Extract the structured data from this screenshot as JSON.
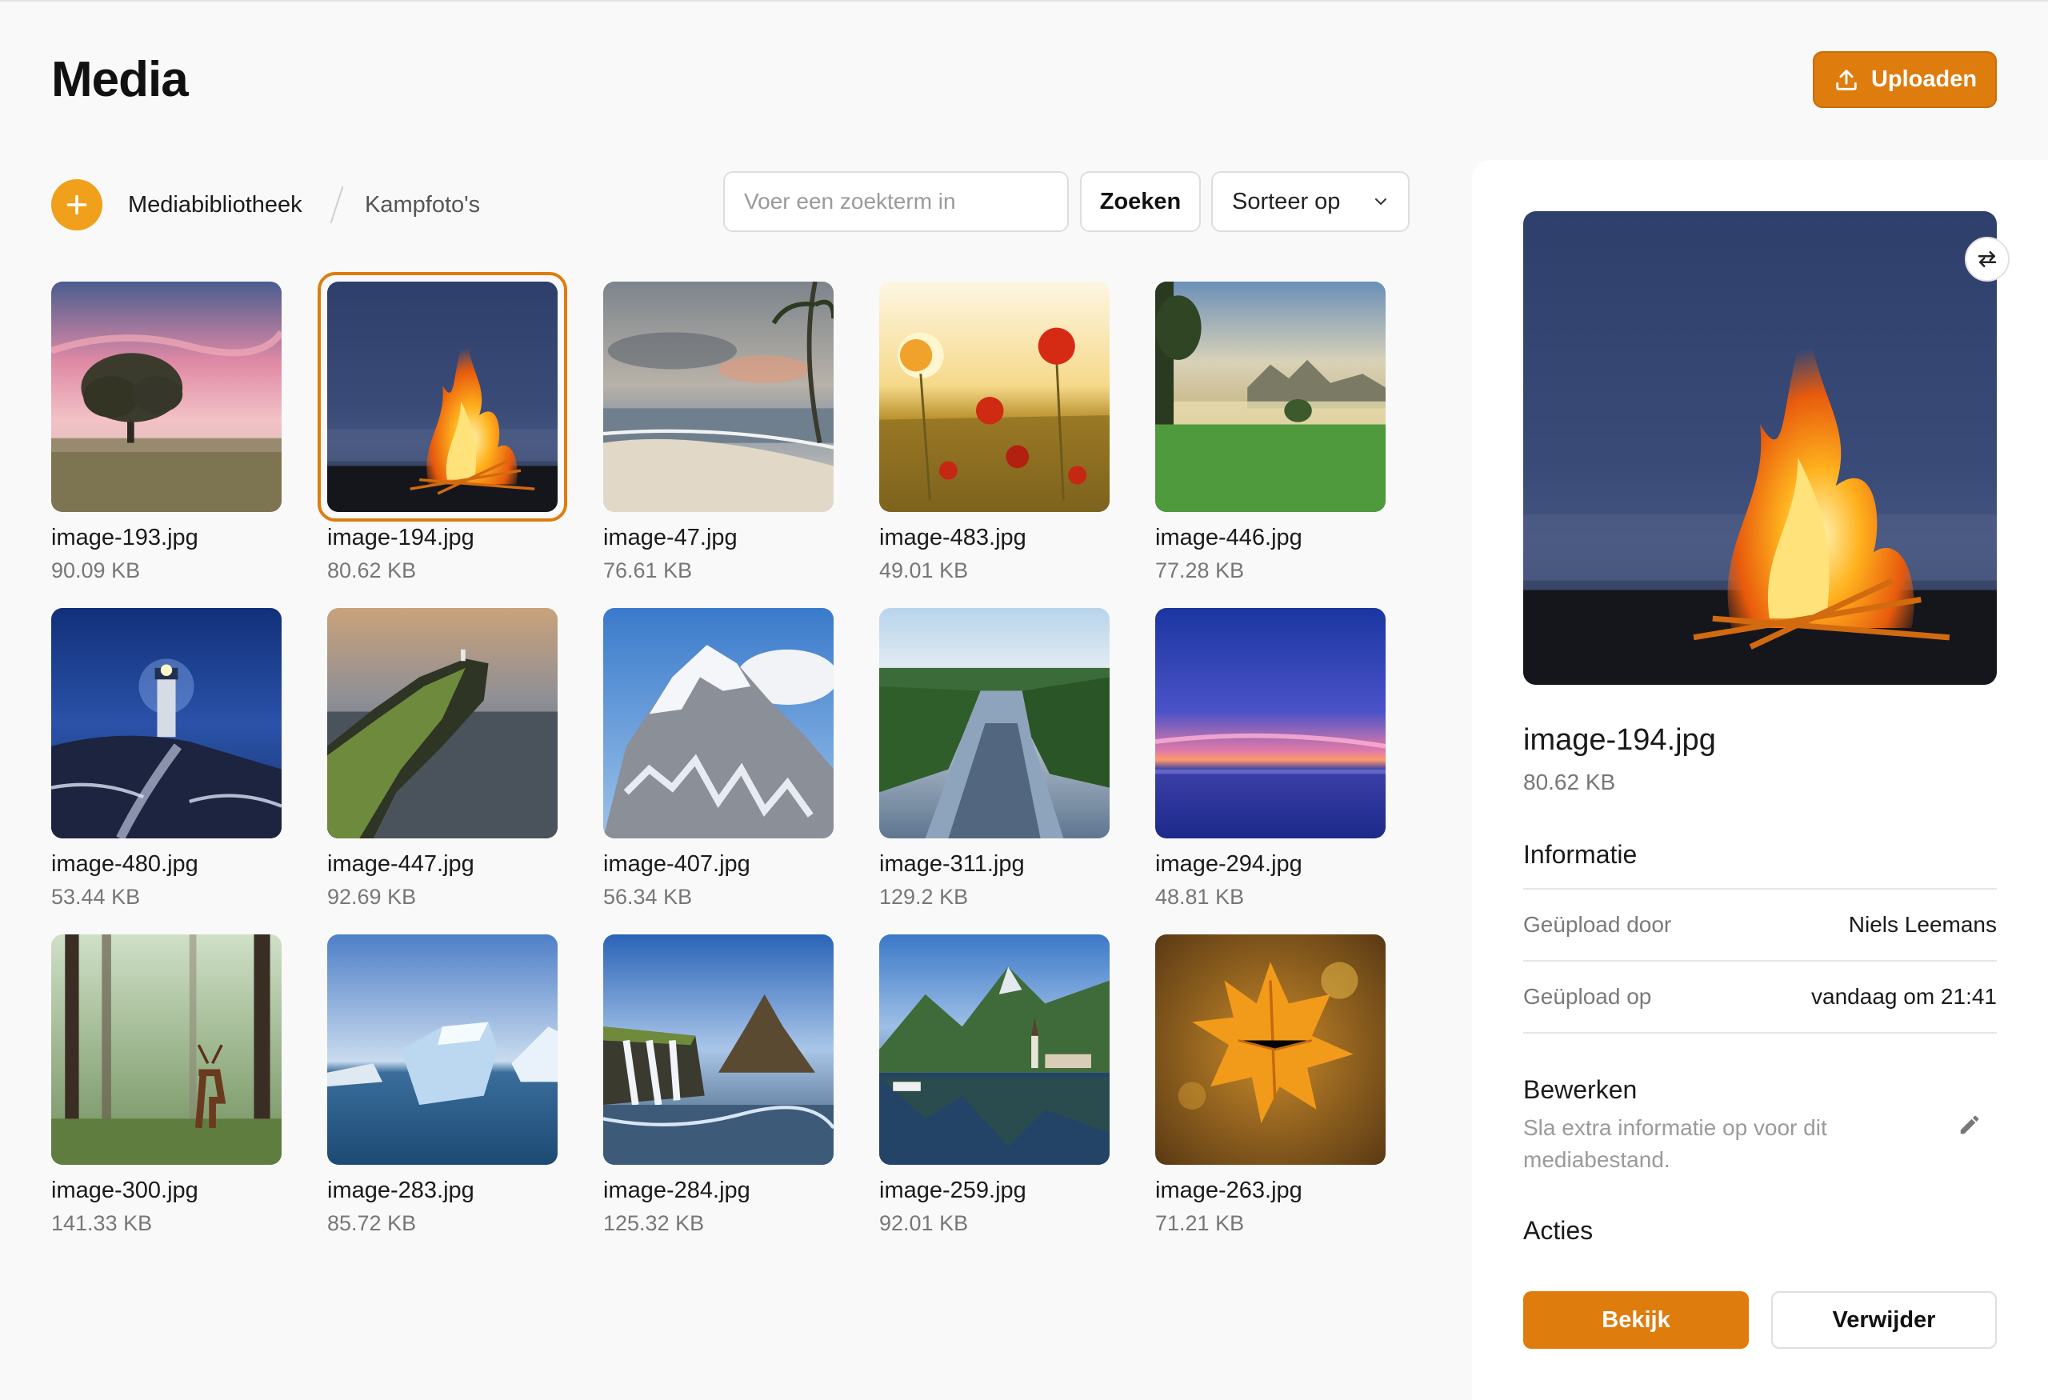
{
  "page": {
    "title": "Media"
  },
  "header": {
    "upload_label": "Uploaden"
  },
  "toolbar": {
    "breadcrumb_root": "Mediabibliotheek",
    "breadcrumb_current": "Kampfoto's",
    "search_placeholder": "Voer een zoekterm in",
    "search_value": "",
    "search_button": "Zoeken",
    "sort_label": "Sorteer op"
  },
  "grid": {
    "selected_index": 1,
    "items": [
      {
        "name": "image-193.jpg",
        "size": "90.09 KB",
        "scene": "tree-sunset"
      },
      {
        "name": "image-194.jpg",
        "size": "80.62 KB",
        "scene": "bonfire"
      },
      {
        "name": "image-47.jpg",
        "size": "76.61 KB",
        "scene": "beach"
      },
      {
        "name": "image-483.jpg",
        "size": "49.01 KB",
        "scene": "poppies"
      },
      {
        "name": "image-446.jpg",
        "size": "77.28 KB",
        "scene": "meadow"
      },
      {
        "name": "image-480.jpg",
        "size": "53.44 KB",
        "scene": "lighthouse"
      },
      {
        "name": "image-447.jpg",
        "size": "92.69 KB",
        "scene": "cliff"
      },
      {
        "name": "image-407.jpg",
        "size": "56.34 KB",
        "scene": "mountain"
      },
      {
        "name": "image-311.jpg",
        "size": "129.2 KB",
        "scene": "river"
      },
      {
        "name": "image-294.jpg",
        "size": "48.81 KB",
        "scene": "dusk-sea"
      },
      {
        "name": "image-300.jpg",
        "size": "141.33 KB",
        "scene": "forest-deer"
      },
      {
        "name": "image-283.jpg",
        "size": "85.72 KB",
        "scene": "iceberg"
      },
      {
        "name": "image-284.jpg",
        "size": "125.32 KB",
        "scene": "waterfall"
      },
      {
        "name": "image-259.jpg",
        "size": "92.01 KB",
        "scene": "lake-village"
      },
      {
        "name": "image-263.jpg",
        "size": "71.21 KB",
        "scene": "autumn-leaf"
      }
    ]
  },
  "detail": {
    "name": "image-194.jpg",
    "size": "80.62 KB",
    "info_title": "Informatie",
    "uploaded_by_label": "Geüpload door",
    "uploaded_by_value": "Niels Leemans",
    "uploaded_on_label": "Geüpload op",
    "uploaded_on_value": "vandaag om 21:41",
    "edit_title": "Bewerken",
    "edit_desc": "Sla extra informatie op voor dit mediabestand.",
    "actions_title": "Acties",
    "view_label": "Bekijk",
    "delete_label": "Verwijder"
  },
  "colors": {
    "accent": "#df7c0e",
    "accent_light": "#f0a01a",
    "panel_bg": "#ffffff",
    "page_bg": "#f9f9f9"
  },
  "icons": [
    "upload-icon",
    "plus-icon",
    "chevron-down-icon",
    "swap-icon",
    "pencil-icon"
  ]
}
